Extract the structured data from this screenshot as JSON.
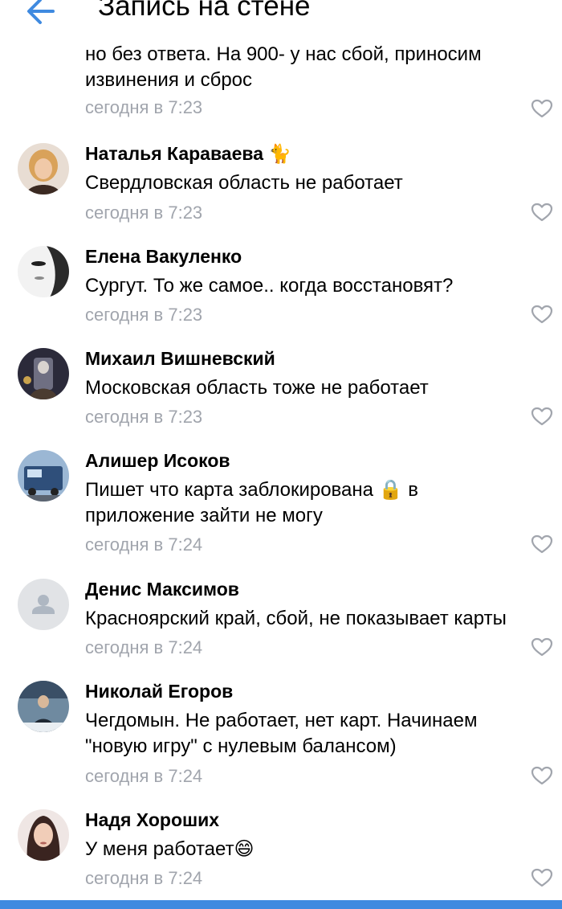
{
  "header": {
    "title": "Запись на стене",
    "back_icon": "arrow-left-icon",
    "accent": "#3f8ae0"
  },
  "partial_comment": {
    "text_line_1": "но без ответа. На 900- у нас сбой, приносим",
    "text_line_2": "извинения и сброс",
    "time": "сегодня в 7:23"
  },
  "comments": [
    {
      "author": "Наталья Караваева 🐈",
      "text": "Свердловская область не работает",
      "time": "сегодня в 7:23"
    },
    {
      "author": "Елена Вакуленко",
      "text": "Сургут. То же самое.. когда восстановят?",
      "time": "сегодня в 7:23"
    },
    {
      "author": "Михаил Вишневский",
      "text": "Московская область тоже не работает",
      "time": "сегодня в 7:23"
    },
    {
      "author": "Алишер Исоков",
      "text_line_1": "Пишет что карта заблокирована 🔒 в",
      "text_line_2": "приложение зайти не могу",
      "time": "сегодня в 7:24"
    },
    {
      "author": "Денис Максимов",
      "text": "Красноярский край, сбой, не показывает карты",
      "time": "сегодня в 7:24"
    },
    {
      "author": "Николай Егоров",
      "text_line_1": "Чегдомын. Не работает, нет карт. Начинаем",
      "text_line_2": "\"новую игру\" с нулевым балансом)",
      "time": "сегодня в 7:24"
    },
    {
      "author": "Надя Хороших",
      "text": "У меня работает😄",
      "time": "сегодня в 7:24"
    }
  ],
  "icons": {
    "like": "heart-icon",
    "default_avatar": "user-placeholder-icon"
  },
  "colors": {
    "meta": "#a1a5ad",
    "heart": "#a1a5ad",
    "bottom_bar": "#3f8ae0"
  }
}
